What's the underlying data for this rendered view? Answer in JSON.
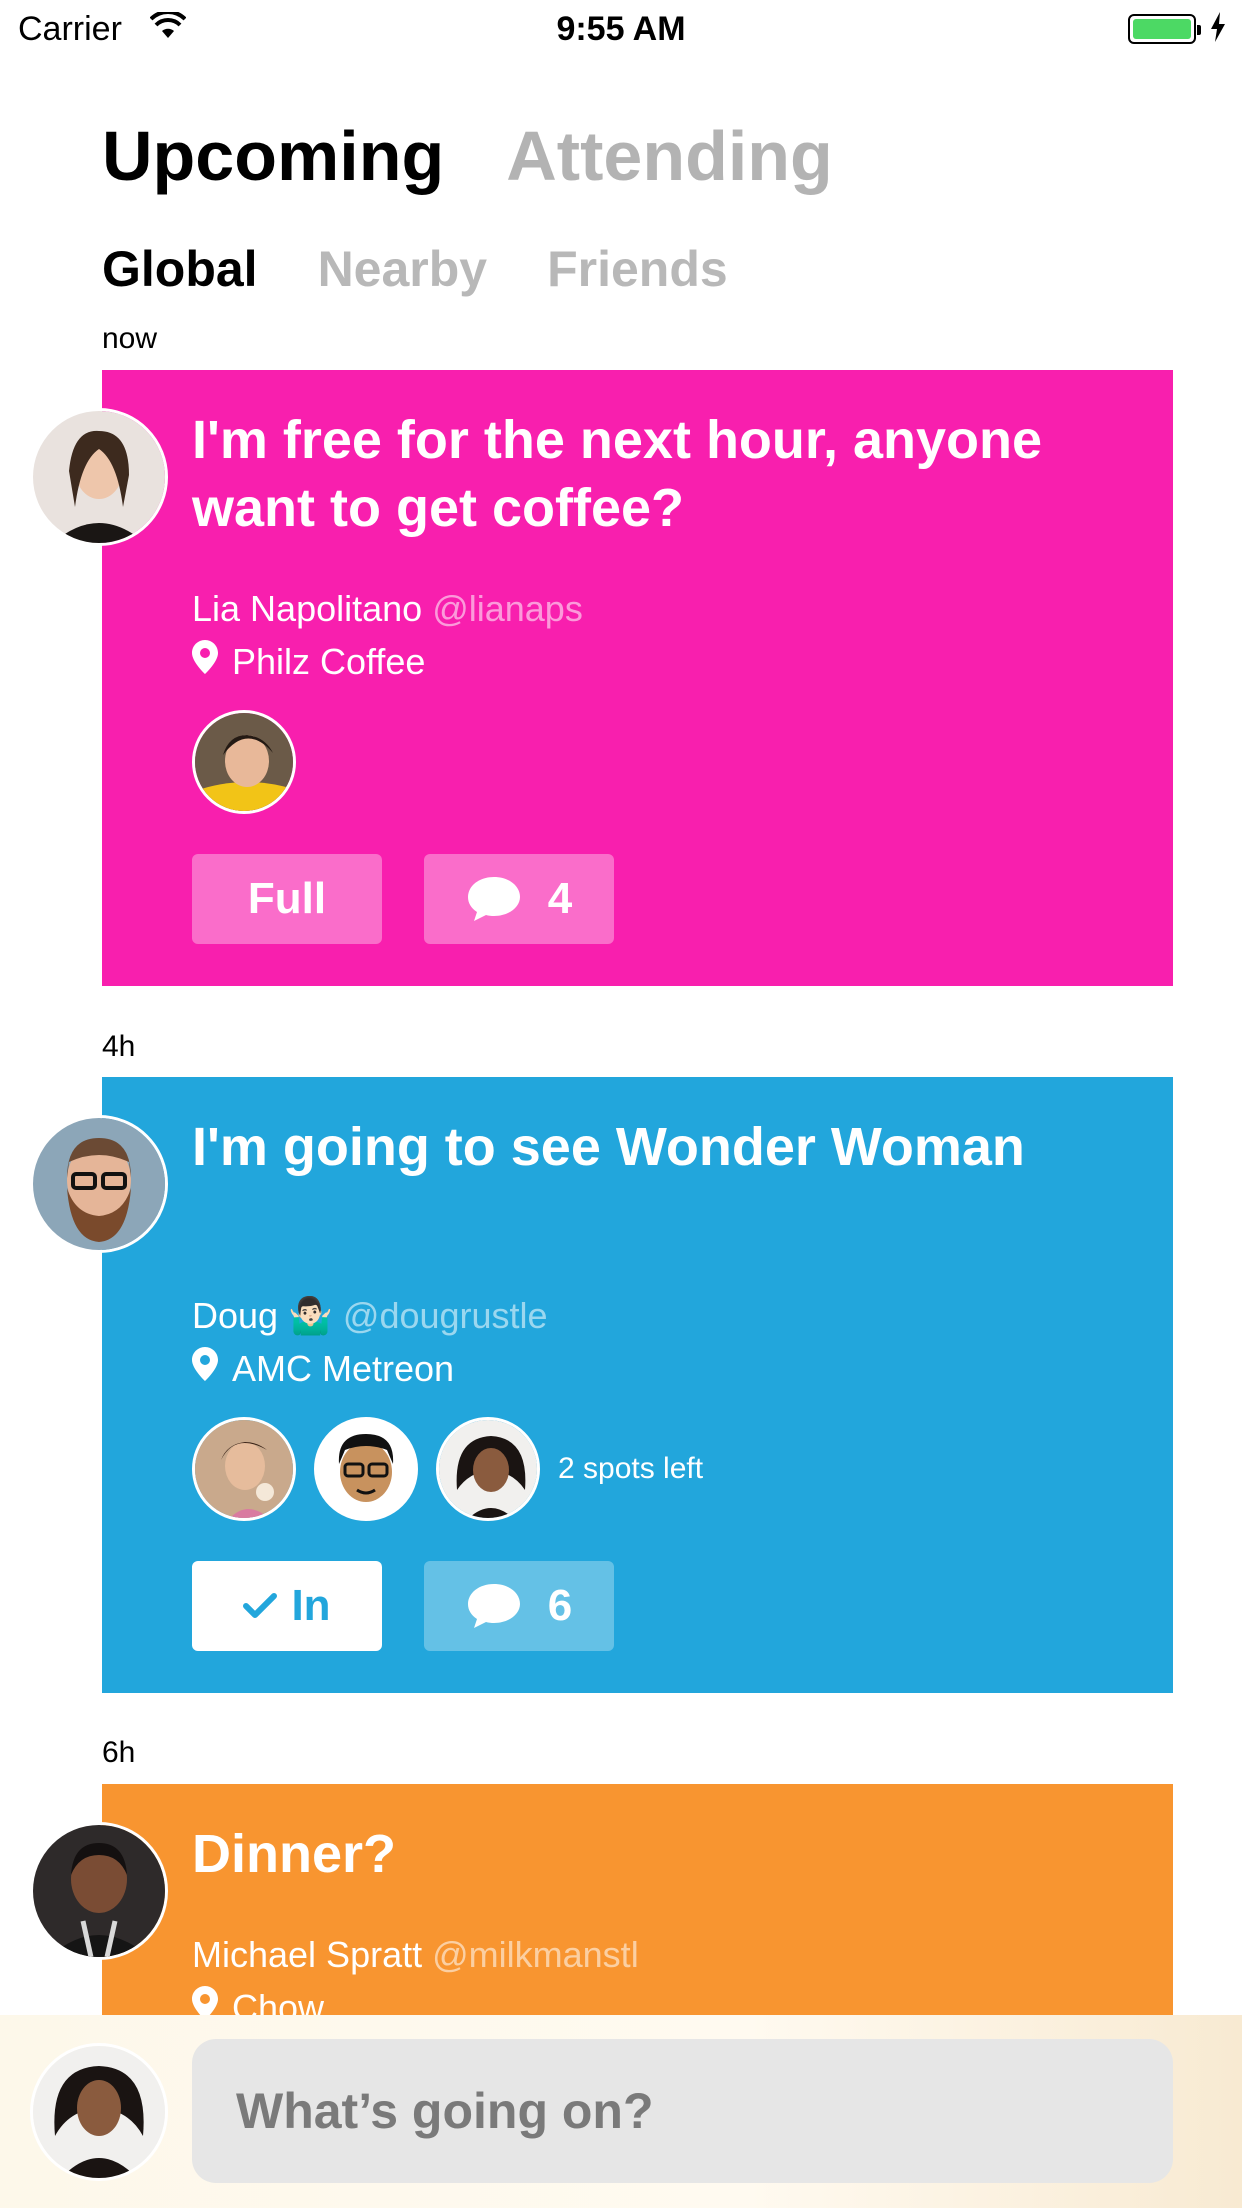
{
  "status_bar": {
    "carrier": "Carrier",
    "time": "9:55 AM"
  },
  "tabs": {
    "main": [
      "Upcoming",
      "Attending"
    ],
    "sub": [
      "Global",
      "Nearby",
      "Friends"
    ]
  },
  "colors": {
    "pink": "#f81fae",
    "blue": "#22a6dc",
    "orange": "#f89530"
  },
  "feed": [
    {
      "time": "now",
      "title": "I'm free for the next hour, anyone want to get coffee?",
      "author": "Lia Napolitano",
      "handle": "@lianaps",
      "location": "Philz Coffee",
      "status_label": "Full",
      "comments": "4"
    },
    {
      "time": "4h",
      "title": "I'm going to see Wonder Woman",
      "author": "Doug 🤷🏻‍♂️",
      "handle": "@dougrustle",
      "location": "AMC Metreon",
      "spots": "2 spots left",
      "status_label": "In",
      "comments": "6"
    },
    {
      "time": "6h",
      "title": "Dinner?",
      "author": "Michael Spratt",
      "handle": "@milkmanstl",
      "location": "Chow"
    }
  ],
  "compose": {
    "placeholder": "What’s going on?"
  }
}
